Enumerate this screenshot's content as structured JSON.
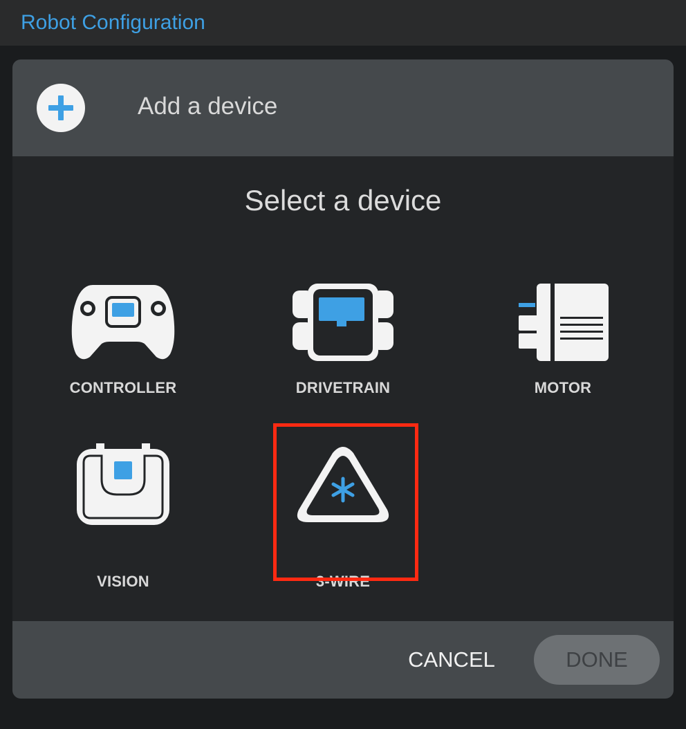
{
  "app": {
    "title": "Robot Configuration"
  },
  "dialog": {
    "header_text": "Add a device",
    "select_title": "Select a device",
    "devices": [
      {
        "label": "CONTROLLER",
        "icon": "gamepad-icon"
      },
      {
        "label": "DRIVETRAIN",
        "icon": "drivetrain-icon"
      },
      {
        "label": "MOTOR",
        "icon": "motor-icon"
      },
      {
        "label": "VISION",
        "icon": "vision-sensor-icon"
      },
      {
        "label": "3-WIRE",
        "icon": "three-wire-icon"
      }
    ],
    "cancel_label": "CANCEL",
    "done_label": "DONE"
  },
  "colors": {
    "accent": "#3ea0e4",
    "highlight": "#ff2a12",
    "icon_fill": "#f3f3f3",
    "dialog_bg": "#232527",
    "panel_bg": "#45494c"
  }
}
